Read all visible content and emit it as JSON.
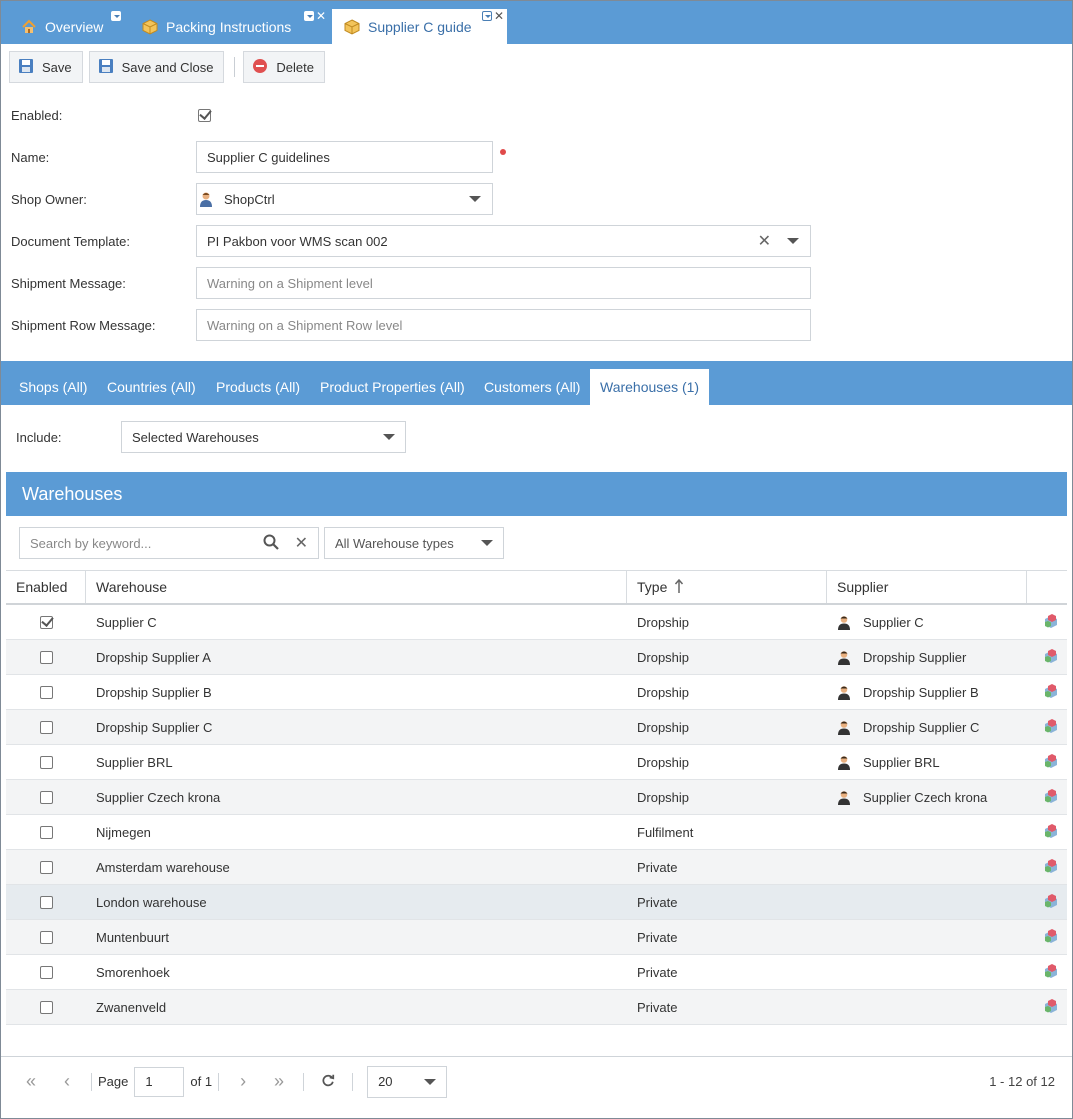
{
  "tabs": [
    {
      "label": "Overview",
      "icon": "home-icon"
    },
    {
      "label": "Packing Instructions",
      "icon": "package-icon"
    },
    {
      "label": "Supplier C guide",
      "icon": "package-icon"
    }
  ],
  "toolbar": {
    "save": "Save",
    "save_close": "Save and Close",
    "delete": "Delete"
  },
  "form": {
    "enabled_label": "Enabled:",
    "enabled": true,
    "name_label": "Name:",
    "name_value": "Supplier C guidelines",
    "owner_label": "Shop Owner:",
    "owner_value": "ShopCtrl",
    "template_label": "Document Template:",
    "template_value": "PI Pakbon voor WMS scan 002",
    "shipment_msg_label": "Shipment Message:",
    "shipment_msg_placeholder": "Warning on a Shipment level",
    "row_msg_label": "Shipment Row Message:",
    "row_msg_placeholder": "Warning on a Shipment Row level"
  },
  "subtabs": [
    "Shops (All)",
    "Countries (All)",
    "Products (All)",
    "Product Properties (All)",
    "Customers (All)",
    "Warehouses (1)"
  ],
  "include": {
    "label": "Include:",
    "value": "Selected Warehouses"
  },
  "panel": {
    "title": "Warehouses",
    "search_placeholder": "Search by keyword...",
    "type_filter": "All Warehouse types"
  },
  "grid": {
    "headers": {
      "enabled": "Enabled",
      "warehouse": "Warehouse",
      "type": "Type",
      "supplier": "Supplier"
    },
    "rows": [
      {
        "enabled": true,
        "warehouse": "Supplier C",
        "type": "Dropship",
        "supplier": "Supplier C"
      },
      {
        "enabled": false,
        "warehouse": "Dropship Supplier A",
        "type": "Dropship",
        "supplier": "Dropship Supplier"
      },
      {
        "enabled": false,
        "warehouse": "Dropship Supplier B",
        "type": "Dropship",
        "supplier": "Dropship Supplier B"
      },
      {
        "enabled": false,
        "warehouse": "Dropship Supplier C",
        "type": "Dropship",
        "supplier": "Dropship Supplier C"
      },
      {
        "enabled": false,
        "warehouse": "Supplier BRL",
        "type": "Dropship",
        "supplier": "Supplier BRL"
      },
      {
        "enabled": false,
        "warehouse": "Supplier Czech krona",
        "type": "Dropship",
        "supplier": "Supplier Czech krona"
      },
      {
        "enabled": false,
        "warehouse": "Nijmegen",
        "type": "Fulfilment",
        "supplier": ""
      },
      {
        "enabled": false,
        "warehouse": "Amsterdam warehouse",
        "type": "Private",
        "supplier": ""
      },
      {
        "enabled": false,
        "warehouse": "London warehouse",
        "type": "Private",
        "supplier": ""
      },
      {
        "enabled": false,
        "warehouse": "Muntenbuurt",
        "type": "Private",
        "supplier": ""
      },
      {
        "enabled": false,
        "warehouse": "Smorenhoek",
        "type": "Private",
        "supplier": ""
      },
      {
        "enabled": false,
        "warehouse": "Zwanenveld",
        "type": "Private",
        "supplier": ""
      }
    ]
  },
  "pager": {
    "page_label": "Page",
    "page": "1",
    "of": "of 1",
    "size": "20",
    "summary": "1 - 12 of 12"
  },
  "colors": {
    "accent": "#5b9bd5",
    "link": "#3a6fa8"
  }
}
